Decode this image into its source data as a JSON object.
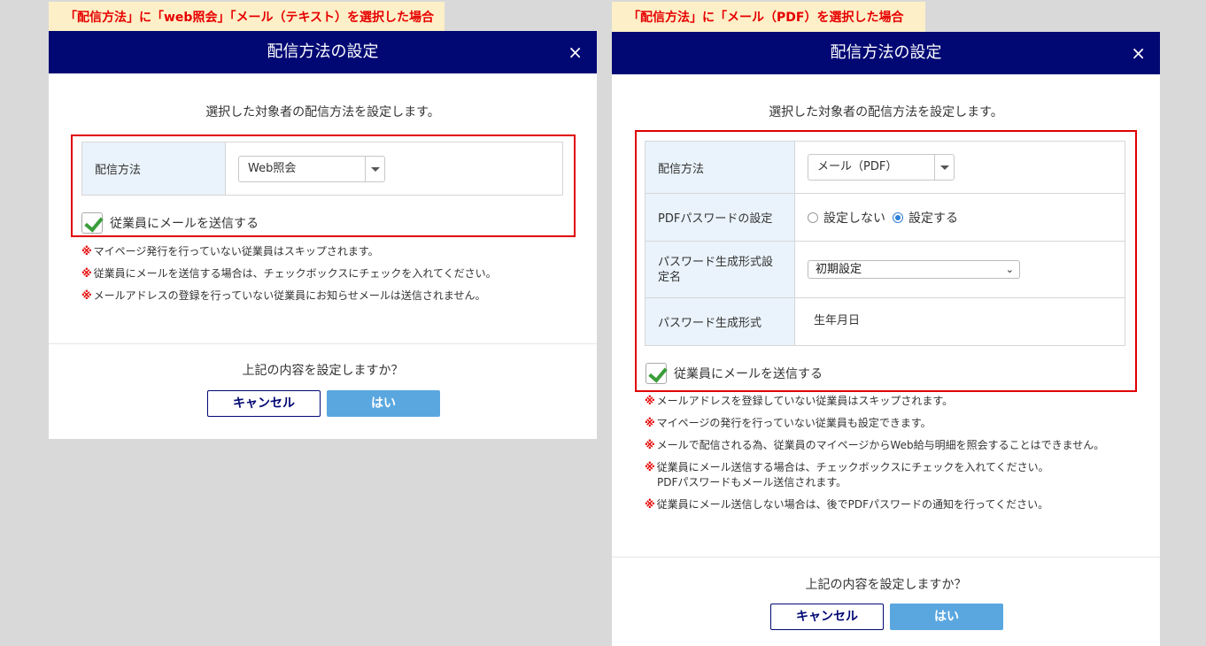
{
  "left": {
    "caption": "「配信方法」に「web照会」「メール（テキスト）を選択した場合",
    "title": "配信方法の設定",
    "close": "×",
    "intro": "選択した対象者の配信方法を設定します。",
    "method_label": "配信方法",
    "method_value": "Web照会",
    "checkbox_label": "従業員にメールを送信する",
    "kome": "※",
    "notes": [
      "マイページ発行を行っていない従業員はスキップされます。",
      "従業員にメールを送信する場合は、チェックボックスにチェックを入れてください。",
      "メールアドレスの登録を行っていない従業員にお知らせメールは送信されません。"
    ],
    "confirm": "上記の内容を設定しますか？",
    "cancel": "キャンセル",
    "yes": "はい"
  },
  "right": {
    "caption": "「配信方法」に「メール（PDF）を選択した場合",
    "title": "配信方法の設定",
    "close": "×",
    "intro": "選択した対象者の配信方法を設定します。",
    "method_label": "配信方法",
    "method_value": "メール（PDF）",
    "pdf_pw_label": "PDFパスワードの設定",
    "radio_off": "設定しない",
    "radio_on": "設定する",
    "pw_format_name_label": "パスワード生成形式設定名",
    "pw_format_name_value": "初期設定",
    "pw_format_label": "パスワード生成形式",
    "pw_format_value": "生年月日",
    "checkbox_label": "従業員にメールを送信する",
    "kome": "※",
    "notes": [
      "メールアドレスを登録していない従業員はスキップされます。",
      "マイページの発行を行っていない従業員も設定できます。",
      "メールで配信される為、従業員のマイページからWeb給与明細を照会することはできません。",
      "従業員にメール送信する場合は、チェックボックスにチェックを入れてください。",
      "従業員にメール送信しない場合は、後でPDFパスワードの通知を行ってください。"
    ],
    "note4_cont": "PDFパスワードもメール送信されます。",
    "confirm": "上記の内容を設定しますか？",
    "cancel": "キャンセル",
    "yes": "はい"
  },
  "colors": {
    "header": "#020873",
    "accent_red": "#e60000",
    "yes_button": "#5aa7e0",
    "label_bg": "#eaf3fb"
  },
  "icons": {
    "close": "close-icon",
    "check": "checkmark-icon",
    "dropdown": "chevron-down-icon"
  }
}
